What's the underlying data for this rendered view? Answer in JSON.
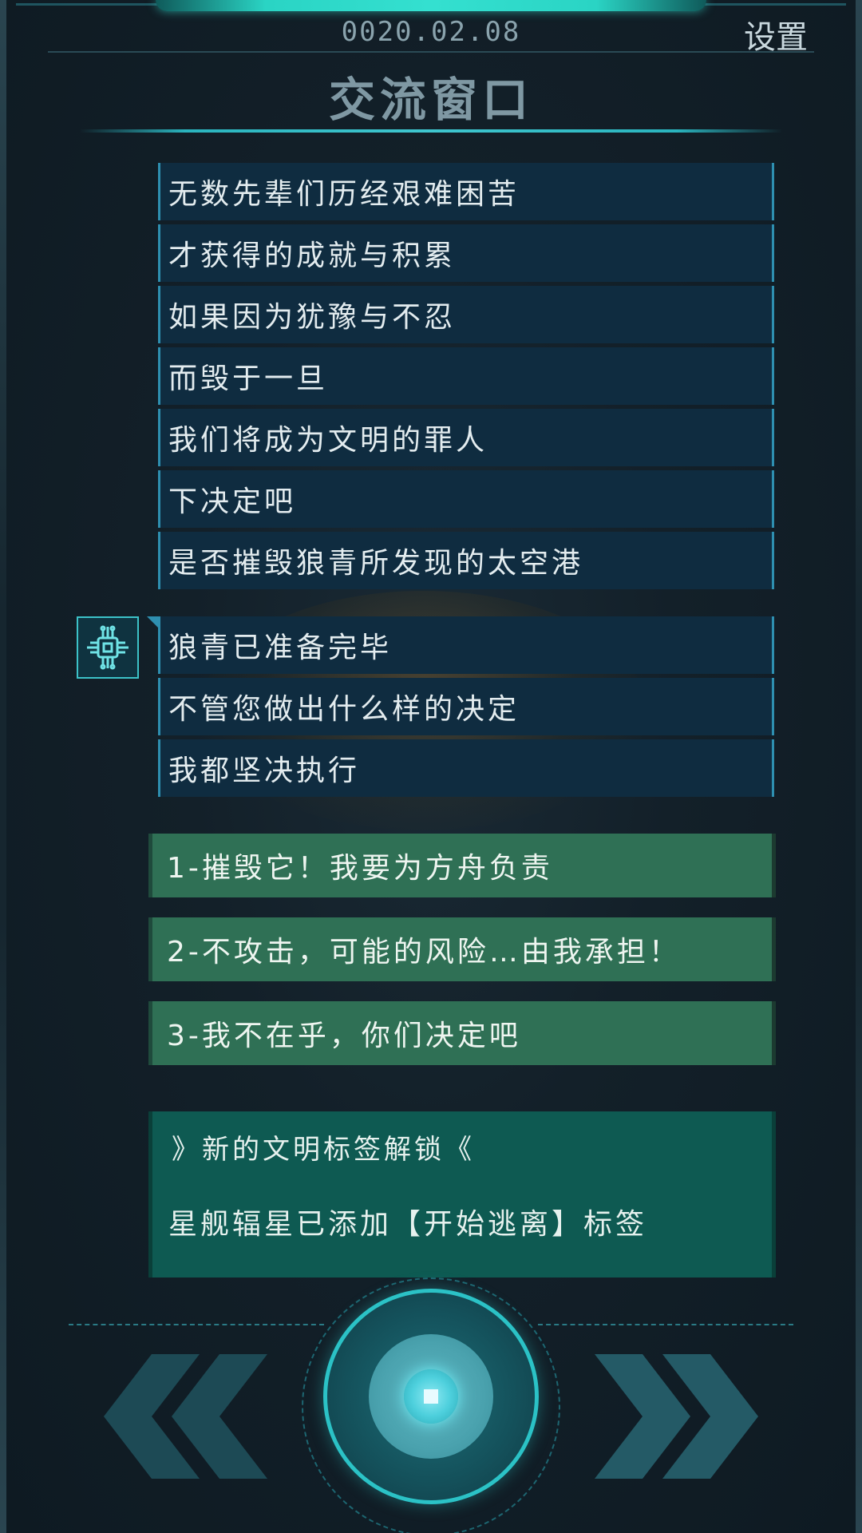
{
  "header": {
    "date": "0020.02.08",
    "settings_label": "设置",
    "title": "交流窗口"
  },
  "messages_group_1": [
    "无数先辈们历经艰难困苦",
    "才获得的成就与积累",
    "如果因为犹豫与不忍",
    "而毁于一旦",
    "我们将成为文明的罪人",
    "下决定吧",
    "是否摧毁狼青所发现的太空港"
  ],
  "messages_group_2": [
    "狼青已准备完毕",
    "不管您做出什么样的决定",
    "我都坚决执行"
  ],
  "choices": [
    "1-摧毁它！我要为方舟负责",
    "2-不攻击，可能的风险…由我承担！",
    "3-我不在乎，你们决定吧"
  ],
  "unlock": {
    "header": "》新的文明标签解锁《",
    "body": "星舰辐星已添加【开始逃离】标签"
  },
  "colors": {
    "accent_cyan": "#2bc2c6",
    "message_bg": "#0f2c40",
    "choice_bg": "#2f7055",
    "unlock_bg": "#0e5a52"
  },
  "icons": {
    "avatar": "chip-icon",
    "left_nav": "double-chevron-left-icon",
    "right_nav": "double-chevron-right-icon",
    "center": "stop-square-icon"
  }
}
